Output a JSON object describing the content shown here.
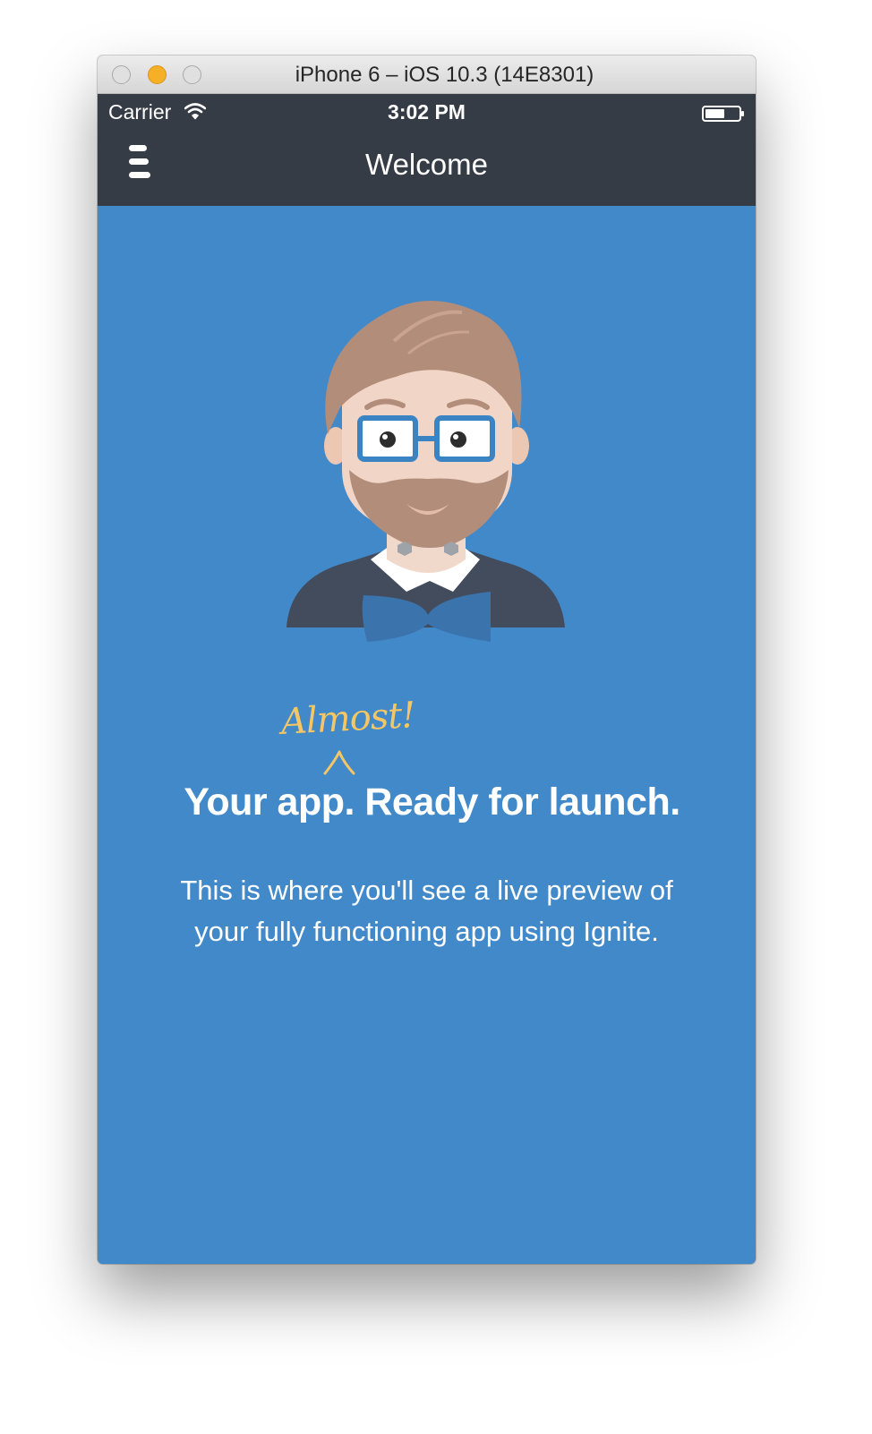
{
  "window": {
    "title": "iPhone 6 – iOS 10.3 (14E8301)",
    "buttons": [
      "close",
      "minimize",
      "zoom"
    ]
  },
  "status_bar": {
    "carrier": "Carrier",
    "time": "3:02 PM",
    "icons": [
      "wifi-icon",
      "battery-icon"
    ]
  },
  "nav": {
    "title": "Welcome",
    "menu_icon": "menu-icon"
  },
  "main": {
    "annotation": "Almost!",
    "headline": "Your app. Ready for launch.",
    "description": "This is where you'll see a live preview of your fully functioning app using Ignite."
  },
  "colors": {
    "background": "#4189c9",
    "header": "#363c45",
    "accent": "#f6c665",
    "text": "#ffffff"
  }
}
